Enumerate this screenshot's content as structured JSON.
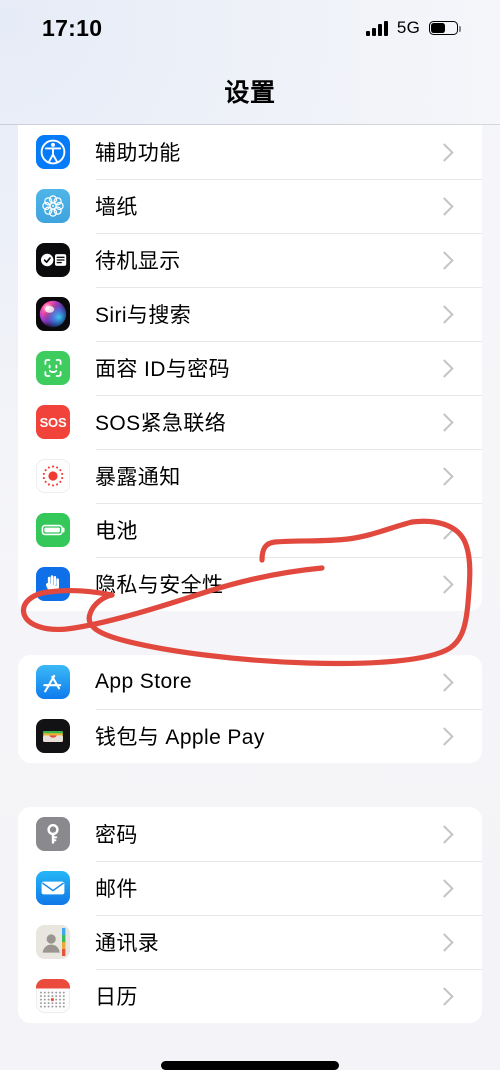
{
  "status_bar": {
    "time": "17:10",
    "network": "5G",
    "signal_icon": "signal-bars-icon",
    "battery_icon": "battery-icon",
    "battery_level_percent": 57
  },
  "nav": {
    "title": "设置"
  },
  "annotation": {
    "type": "handwritten-circle",
    "color": "#E2493E",
    "stroke_width": 5,
    "encircles": [
      "电池",
      "隐私与安全性"
    ]
  },
  "colors": {
    "page_background": "#F2F2F7",
    "card_background": "#FFFFFF",
    "separator": "rgba(60,60,67,0.13)",
    "chevron": "#C4C4C8",
    "label_text": "#000000",
    "annotation_red": "#E2493E"
  },
  "groups": [
    {
      "clipped_top": true,
      "rows": [
        {
          "label": "辅助功能",
          "icon": "accessibility-icon",
          "chevron": "chevron-right-icon"
        },
        {
          "label": "墙纸",
          "icon": "wallpaper-icon",
          "chevron": "chevron-right-icon"
        },
        {
          "label": "待机显示",
          "icon": "standby-icon",
          "chevron": "chevron-right-icon"
        },
        {
          "label": "Siri与搜索",
          "icon": "siri-icon",
          "chevron": "chevron-right-icon"
        },
        {
          "label": "面容 ID与密码",
          "icon": "face-id-icon",
          "chevron": "chevron-right-icon"
        },
        {
          "label": "SOS紧急联络",
          "icon": "emergency-sos-icon",
          "chevron": "chevron-right-icon"
        },
        {
          "label": "暴露通知",
          "icon": "exposure-notifications-icon",
          "chevron": "chevron-right-icon"
        },
        {
          "label": "电池",
          "icon": "battery-settings-icon",
          "chevron": "chevron-right-icon"
        },
        {
          "label": "隐私与安全性",
          "icon": "privacy-hand-icon",
          "chevron": "chevron-right-icon"
        }
      ]
    },
    {
      "clipped_top": false,
      "rows": [
        {
          "label": "App Store",
          "icon": "app-store-icon",
          "chevron": "chevron-right-icon"
        },
        {
          "label": "钱包与 Apple Pay",
          "icon": "wallet-icon",
          "chevron": "chevron-right-icon"
        }
      ]
    },
    {
      "clipped_top": false,
      "rows": [
        {
          "label": "密码",
          "icon": "passwords-key-icon",
          "chevron": "chevron-right-icon"
        },
        {
          "label": "邮件",
          "icon": "mail-icon",
          "chevron": "chevron-right-icon"
        },
        {
          "label": "通讯录",
          "icon": "contacts-icon",
          "chevron": "chevron-right-icon"
        },
        {
          "label": "日历",
          "icon": "calendar-icon",
          "chevron": "chevron-right-icon"
        }
      ]
    }
  ]
}
